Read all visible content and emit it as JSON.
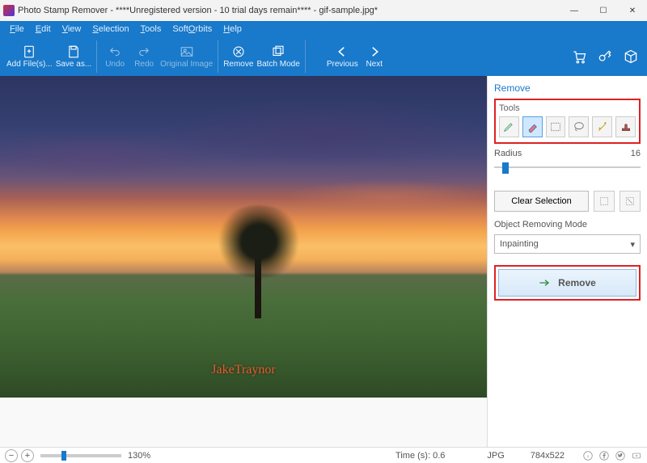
{
  "title": "Photo Stamp Remover - ****Unregistered version - 10 trial days remain**** - gif-sample.jpg*",
  "menubar": [
    "File",
    "Edit",
    "View",
    "Selection",
    "Tools",
    "SoftOrbits",
    "Help"
  ],
  "toolbar": {
    "add": "Add File(s)...",
    "save": "Save as...",
    "undo": "Undo",
    "redo": "Redo",
    "original": "Original Image",
    "remove": "Remove",
    "batch": "Batch Mode",
    "prev": "Previous",
    "next": "Next"
  },
  "panel": {
    "tab": "Remove",
    "tools_label": "Tools",
    "radius_label": "Radius",
    "radius_value": "16",
    "clear": "Clear Selection",
    "mode_label": "Object Removing Mode",
    "mode_value": "Inpainting",
    "remove_btn": "Remove"
  },
  "watermark": "JakeTraynor",
  "status": {
    "zoom": "130%",
    "time": "Time (s): 0.6",
    "format": "JPG",
    "dims": "784x522"
  }
}
